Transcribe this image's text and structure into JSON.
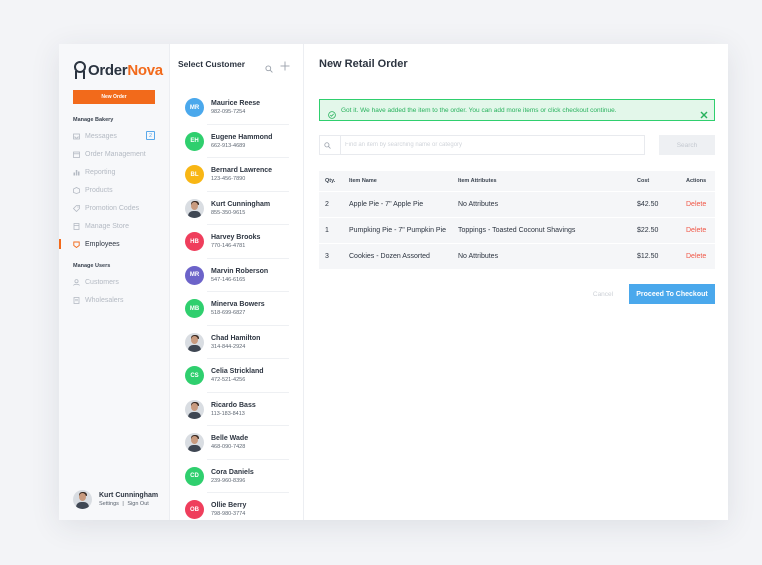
{
  "app": {
    "logo_part1": "Order",
    "logo_part2": "Nova",
    "brand_color": "#f26a1b",
    "accent_color": "#4aa8ec"
  },
  "nav": {
    "new_order_label": "New Order",
    "section_bakery": "Manage Bakery",
    "items": [
      {
        "label": "Messages",
        "icon": "inbox-icon",
        "badge": "2"
      },
      {
        "label": "Order Management",
        "icon": "calendar-icon"
      },
      {
        "label": "Reporting",
        "icon": "bar-chart-icon"
      },
      {
        "label": "Products",
        "icon": "box-icon"
      },
      {
        "label": "Promotion Codes",
        "icon": "tag-icon"
      },
      {
        "label": "Manage Store",
        "icon": "store-icon"
      },
      {
        "label": "Employees",
        "icon": "badge-icon",
        "active": true
      }
    ],
    "section_users": "Manage Users",
    "user_items": [
      {
        "label": "Customers",
        "icon": "user-icon"
      },
      {
        "label": "Wholesalers",
        "icon": "document-icon"
      }
    ],
    "user": {
      "name": "Kurt Cunningham",
      "settings": "Settings",
      "separator": "|",
      "signout": "Sign Out"
    }
  },
  "customers": {
    "title": "Select Customer",
    "list": [
      {
        "initials": "MR",
        "name": "Maurice Reese",
        "phone": "982-095-7254",
        "color": "#4aa8ec"
      },
      {
        "initials": "EH",
        "name": "Eugene Hammond",
        "phone": "662-913-4689",
        "color": "#2fcf6e"
      },
      {
        "initials": "BL",
        "name": "Bernard Lawrence",
        "phone": "123-456-7890",
        "color": "#f8b614"
      },
      {
        "initials": "",
        "name": "Kurt Cunningham",
        "phone": "855-350-9615",
        "photo": true
      },
      {
        "initials": "HB",
        "name": "Harvey Brooks",
        "phone": "770-146-4781",
        "color": "#ef3e5c"
      },
      {
        "initials": "MR",
        "name": "Marvin Roberson",
        "phone": "547-146-6165",
        "color": "#6c63c9"
      },
      {
        "initials": "MB",
        "name": "Minerva Bowers",
        "phone": "518-699-6827",
        "color": "#2fcf6e"
      },
      {
        "initials": "",
        "name": "Chad Hamilton",
        "phone": "314-844-2924",
        "photo": true
      },
      {
        "initials": "CS",
        "name": "Celia Strickland",
        "phone": "472-521-4256",
        "color": "#2fcf6e"
      },
      {
        "initials": "",
        "name": "Ricardo Bass",
        "phone": "113-183-8413",
        "photo": true
      },
      {
        "initials": "",
        "name": "Belle Wade",
        "phone": "468-090-7428",
        "photo": true
      },
      {
        "initials": "CD",
        "name": "Cora Daniels",
        "phone": "239-960-8396",
        "color": "#2fcf6e"
      },
      {
        "initials": "OB",
        "name": "Ollie Berry",
        "phone": "798-980-3774",
        "color": "#ef3e5c"
      }
    ]
  },
  "main": {
    "title": "New Retail Order",
    "alert": "Got it. We have added the item to the order. You can add more items or click checkout continue.",
    "search_placeholder": "Find an item by searching name or category",
    "search_button": "Search",
    "table": {
      "headers": {
        "qty": "Qty.",
        "name": "Item Name",
        "attrs": "Item Attributes",
        "cost": "Cost",
        "actions": "Actions"
      },
      "rows": [
        {
          "qty": "2",
          "name": "Apple Pie - 7\" Apple Pie",
          "attrs": "No Attributes",
          "cost": "$42.50",
          "action": "Delete"
        },
        {
          "qty": "1",
          "name": "Pumpking Pie - 7\" Pumpkin Pie",
          "attrs": "Toppings - Toasted Coconut Shavings",
          "cost": "$22.50",
          "action": "Delete"
        },
        {
          "qty": "3",
          "name": "Cookies - Dozen Assorted",
          "attrs": "No Attributes",
          "cost": "$12.50",
          "action": "Delete"
        }
      ]
    },
    "cancel": "Cancel",
    "checkout": "Proceed To Checkout"
  }
}
